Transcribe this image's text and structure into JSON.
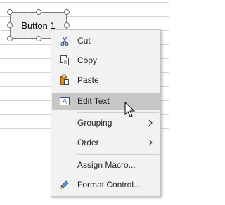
{
  "form_button": {
    "label": "Button 1"
  },
  "context_menu": {
    "items": [
      {
        "label": "Cut",
        "icon": "scissors-icon",
        "has_submenu": false
      },
      {
        "label": "Copy",
        "icon": "copy-icon",
        "has_submenu": false
      },
      {
        "label": "Paste",
        "icon": "paste-icon",
        "has_submenu": false
      },
      {
        "label": "Edit Text",
        "icon": "edit-text-icon",
        "has_submenu": false,
        "highlighted": true
      },
      {
        "label": "Grouping",
        "icon": "",
        "has_submenu": true
      },
      {
        "label": "Order",
        "icon": "",
        "has_submenu": true
      },
      {
        "label": "Assign Macro...",
        "icon": "",
        "has_submenu": false
      },
      {
        "label": "Format Control...",
        "icon": "format-control-icon",
        "has_submenu": false
      }
    ]
  },
  "colors": {
    "menu_background": "#f2f2f2",
    "hover_background": "#c7c7c7",
    "gridline": "#d4d4d4",
    "button_face": "#efefef",
    "icon_blue": "#2b579a",
    "icon_orange": "#d68b1a"
  }
}
